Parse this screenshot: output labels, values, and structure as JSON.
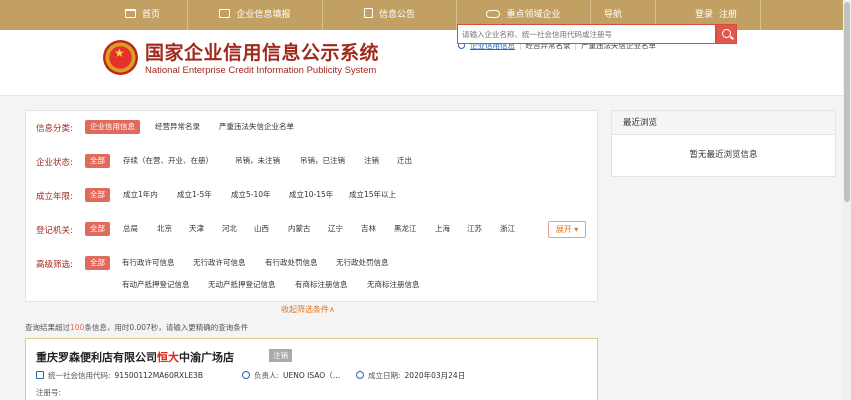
{
  "nav": {
    "items": [
      {
        "label": "首页",
        "icon": "home-icon"
      },
      {
        "label": "企业信息填报",
        "icon": "edit-icon"
      },
      {
        "label": "信息公告",
        "icon": "document-icon"
      },
      {
        "label": "重点领域企业",
        "icon": "globe-icon"
      },
      {
        "label": "导航",
        "icon": ""
      }
    ],
    "login": "登录",
    "register": "注册",
    "bar_color": "#c2a064"
  },
  "header": {
    "title": "国家企业信用信息公示系统",
    "subtitle": "National Enterprise Credit Information Publicity System",
    "brand_color": "#a0281d"
  },
  "search": {
    "tabs": [
      "企业信用信息",
      "经营异常名录",
      "严重违法失信企业名单"
    ],
    "active_tab": "企业信用信息",
    "placeholder": "请输入企业名称、统一社会信用代码或注册号",
    "value": ""
  },
  "filters": {
    "category": {
      "label": "信息分类:",
      "options": [
        "企业信用信息",
        "经营异常名录",
        "严重违法失信企业名单"
      ],
      "selected": "企业信用信息"
    },
    "status": {
      "label": "企业状态:",
      "options": [
        "全部",
        "存续（在营、开业、在册）",
        "吊销，未注销",
        "吊销，已注销",
        "注销",
        "迁出"
      ],
      "selected": "全部"
    },
    "years": {
      "label": "成立年限:",
      "options": [
        "全部",
        "成立1年内",
        "成立1-5年",
        "成立5-10年",
        "成立10-15年",
        "成立15年以上"
      ],
      "selected": "全部"
    },
    "authority": {
      "label": "登记机关:",
      "options": [
        "全部",
        "总局",
        "北京",
        "天津",
        "河北",
        "山西",
        "内蒙古",
        "辽宁",
        "吉林",
        "黑龙江",
        "上海",
        "江苏",
        "浙江"
      ],
      "selected": "全部",
      "expand": "展开"
    },
    "advanced": {
      "label": "高级筛选:",
      "options": [
        "全部",
        "有行政许可信息",
        "无行政许可信息",
        "有行政处罚信息",
        "无行政处罚信息",
        "有动产抵押登记信息",
        "无动产抵押登记信息",
        "有商标注册信息",
        "无商标注册信息"
      ],
      "selected": "全部"
    },
    "collapse": "收起筛选条件∧",
    "accent": "#e06a5c"
  },
  "summary": {
    "before": "查询结果超过",
    "count": "100",
    "after": "条信息，用时0.007秒，请输入更精确的查询条件"
  },
  "recent": {
    "title": "最近浏览",
    "empty": "暂无最近浏览信息"
  },
  "result": {
    "name_prefix": "重庆罗森便利店有限公司",
    "name_highlight": "恒大",
    "name_suffix": "中渝广场店",
    "status": "注销",
    "credit_code_label": "统一社会信用代码:",
    "credit_code": "91500112MA60RXLE3B",
    "person_label": "负责人:",
    "person": "UENO ISAO（…",
    "date_label": "成立日期:",
    "date": "2020年03月24日",
    "reg_label": "注册号:"
  }
}
